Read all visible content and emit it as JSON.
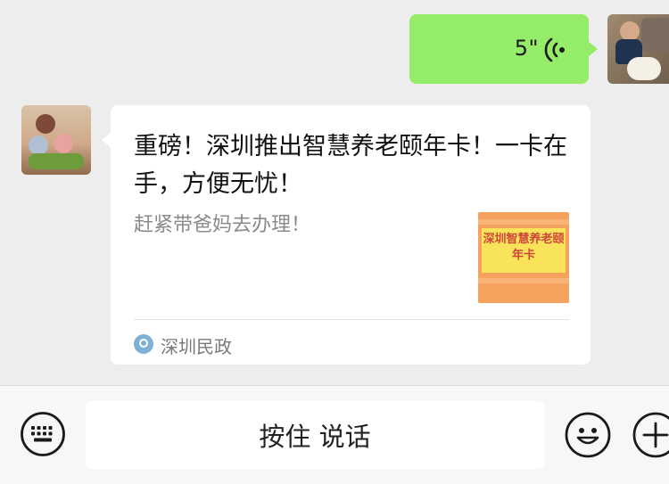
{
  "messages": {
    "outgoing_voice": {
      "duration": "5\"",
      "icon": "voice-wave-icon"
    },
    "incoming_link": {
      "title": "重磅！深圳推出智慧养老颐年卡！一卡在手，方便无忧！",
      "description": "赶紧带爸妈去办理！",
      "thumbnail_text": "深圳智慧养老颐年卡",
      "source": "深圳民政",
      "source_icon": "source-logo-icon"
    }
  },
  "input_bar": {
    "talk_label": "按住 说话",
    "left_icon": "keyboard-icon",
    "right_icons": [
      "emoji-icon",
      "plus-icon"
    ]
  },
  "colors": {
    "background": "#ededed",
    "voice_bubble": "#95ec69",
    "card_bg": "#ffffff",
    "thumb_text": "#d0453b"
  }
}
